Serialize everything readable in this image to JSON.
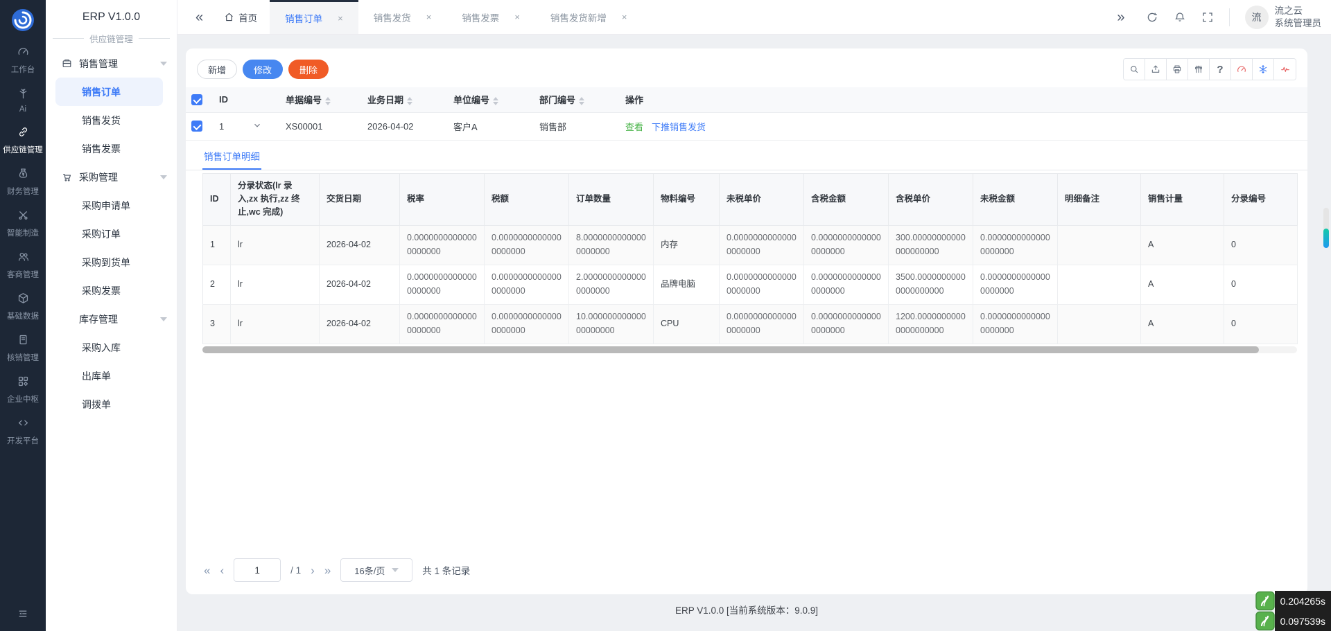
{
  "app": {
    "footer": "ERP V1.0.0 [当前系统版本：9.0.9]"
  },
  "rail": {
    "items": [
      {
        "label": "工作台",
        "icon": "dashboard-icon",
        "active": false
      },
      {
        "label": "Ai",
        "icon": "ai-tree-icon",
        "active": false
      },
      {
        "label": "供应链管理",
        "icon": "chain-icon",
        "active": true
      },
      {
        "label": "财务管理",
        "icon": "money-bag-icon",
        "active": false
      },
      {
        "label": "智能制造",
        "icon": "tools-icon",
        "active": false
      },
      {
        "label": "客商管理",
        "icon": "people-icon",
        "active": false
      },
      {
        "label": "基础数据",
        "icon": "cube-icon",
        "active": false
      },
      {
        "label": "核销管理",
        "icon": "ledger-icon",
        "active": false
      },
      {
        "label": "企业中枢",
        "icon": "grid-icon",
        "active": false
      },
      {
        "label": "开发平台",
        "icon": "code-icon",
        "active": false
      }
    ]
  },
  "sidebar": {
    "title": "ERP V1.0.0",
    "section": "供应链管理",
    "menu": [
      {
        "label": "销售管理",
        "icon": "shop-icon",
        "children": [
          {
            "label": "销售订单",
            "active": true
          },
          {
            "label": "销售发货",
            "active": false
          },
          {
            "label": "销售发票",
            "active": false
          }
        ]
      },
      {
        "label": "采购管理",
        "icon": "cart-icon",
        "children": [
          {
            "label": "采购申请单",
            "active": false
          },
          {
            "label": "采购订单",
            "active": false
          },
          {
            "label": "采购到货单",
            "active": false
          },
          {
            "label": "采购发票",
            "active": false
          }
        ]
      },
      {
        "label": "库存管理",
        "icon": "",
        "children": [
          {
            "label": "采购入库",
            "active": false
          },
          {
            "label": "出库单",
            "active": false
          },
          {
            "label": "调拨单",
            "active": false
          }
        ]
      }
    ]
  },
  "tabbar": {
    "home_label": "首页",
    "tabs": [
      {
        "label": "销售订单",
        "active": true
      },
      {
        "label": "销售发货",
        "active": false
      },
      {
        "label": "销售发票",
        "active": false
      },
      {
        "label": "销售发货新增",
        "active": false
      }
    ],
    "user": {
      "avatar_text": "流",
      "name": "流之云",
      "role": "系统管理员"
    }
  },
  "toolbar": {
    "buttons": [
      {
        "label": "新增",
        "style": "default"
      },
      {
        "label": "修改",
        "style": "primary"
      },
      {
        "label": "删除",
        "style": "danger"
      }
    ],
    "icons": [
      "search-icon",
      "import-icon",
      "print-icon",
      "custom-columns-icon",
      "help-icon",
      "gauge-icon",
      "snowflake-icon",
      "pulse-icon"
    ]
  },
  "orders_table": {
    "columns": [
      {
        "label": "ID",
        "sortable": false
      },
      {
        "label": "单据编号",
        "sortable": true
      },
      {
        "label": "业务日期",
        "sortable": true
      },
      {
        "label": "单位编号",
        "sortable": true
      },
      {
        "label": "部门编号",
        "sortable": true
      },
      {
        "label": "操作",
        "sortable": false
      }
    ],
    "rows": [
      {
        "checked": true,
        "id": "1",
        "doc_no": "XS00001",
        "biz_date": "2026-04-02",
        "unit": "客户A",
        "dept": "销售部",
        "actions": [
          {
            "label": "查看",
            "color": "green"
          },
          {
            "label": "下推销售发货",
            "color": "blue"
          }
        ]
      }
    ]
  },
  "detail": {
    "tab_label": "销售订单明细",
    "columns": [
      "ID",
      "分录状态(lr 录入,zx 执行,zz 终止,wc 完成)",
      "交货日期",
      "税率",
      "税额",
      "订单数量",
      "物料编号",
      "未税单价",
      "含税金额",
      "含税单价",
      "未税金额",
      "明细备注",
      "销售计量",
      "分录编号"
    ],
    "rows": [
      [
        "1",
        "lr",
        "2026-04-02",
        "0.00000000000000000000",
        "0.00000000000000000000",
        "8.00000000000000000000",
        "内存",
        "0.00000000000000000000",
        "0.00000000000000000000",
        "300.00000000000000000000",
        "0.00000000000000000000",
        "",
        "A",
        "0"
      ],
      [
        "2",
        "lr",
        "2026-04-02",
        "0.00000000000000000000",
        "0.00000000000000000000",
        "2.00000000000000000000",
        "品牌电脑",
        "0.00000000000000000000",
        "0.00000000000000000000",
        "3500.00000000000000000000",
        "0.00000000000000000000",
        "",
        "A",
        "0"
      ],
      [
        "3",
        "lr",
        "2026-04-02",
        "0.00000000000000000000",
        "0.00000000000000000000",
        "10.00000000000000000000",
        "CPU",
        "0.00000000000000000000",
        "0.00000000000000000000",
        "1200.00000000000000000000",
        "0.00000000000000000000",
        "",
        "A",
        "0"
      ]
    ]
  },
  "pagination": {
    "page_value": "1",
    "total_pages": "/ 1",
    "page_size": "16条/页",
    "total_text": "共 1 条记录"
  },
  "perf": {
    "badges": [
      "0.204265s",
      "0.097539s"
    ]
  },
  "colors": {
    "accent": "#3e7bf7",
    "danger": "#f05b26",
    "success": "#47b347",
    "rail_bg": "#1d2736"
  }
}
